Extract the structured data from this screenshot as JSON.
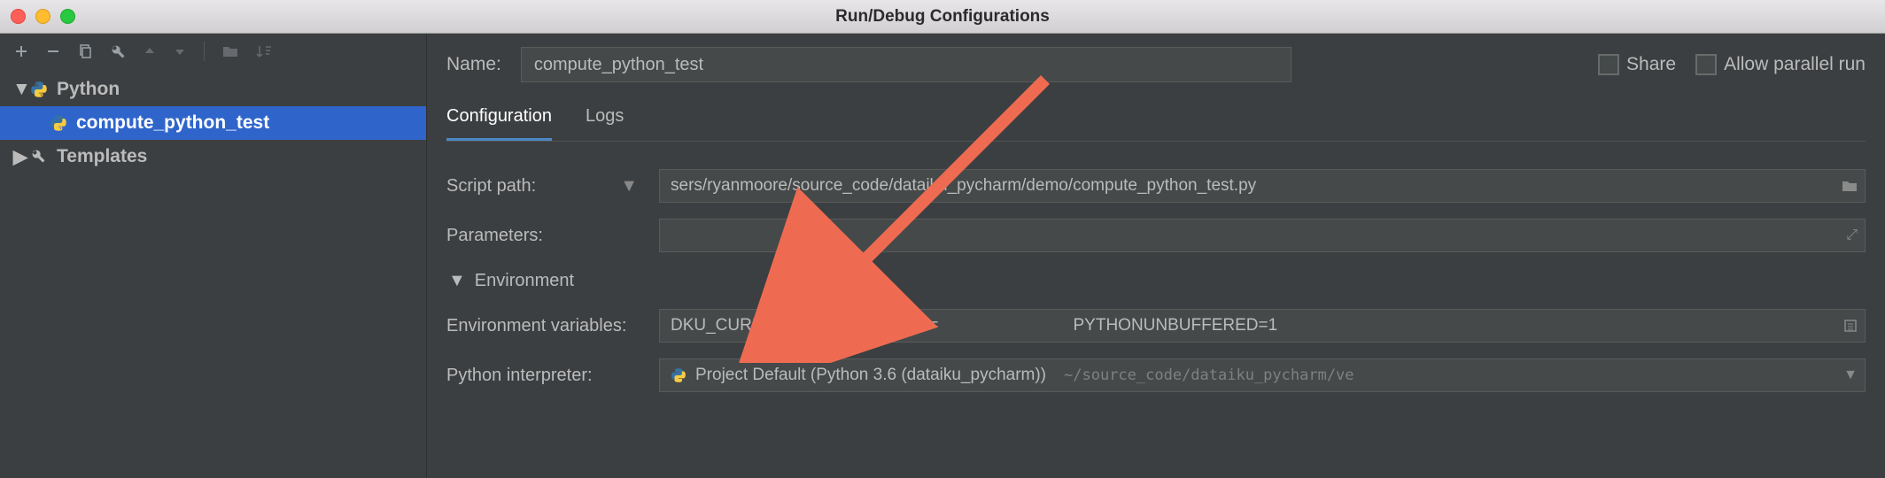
{
  "window": {
    "title": "Run/Debug Configurations"
  },
  "tree": {
    "python_group": "Python",
    "selected_config": "compute_python_test",
    "templates_group": "Templates"
  },
  "name": {
    "label": "Name:",
    "value": "compute_python_test",
    "share_label": "Share",
    "parallel_label": "Allow parallel run"
  },
  "tabs": {
    "config": "Configuration",
    "logs": "Logs"
  },
  "form": {
    "script_path_label": "Script path:",
    "script_path_value": "sers/ryanmoore/source_code/dataiku_pycharm/demo/compute_python_test.py",
    "parameters_label": "Parameters:",
    "parameters_value": "",
    "environment_header": "Environment",
    "env_vars_label": "Environment variables:",
    "env_vars_value": "DKU_CURRENT_PROJECT_KEY=        PYTHONUNBUFFERED=1",
    "interpreter_label": "Python interpreter:",
    "interpreter_name": "Project Default (Python 3.6 (dataiku_pycharm))",
    "interpreter_path": "~/source_code/dataiku_pycharm/ve"
  }
}
